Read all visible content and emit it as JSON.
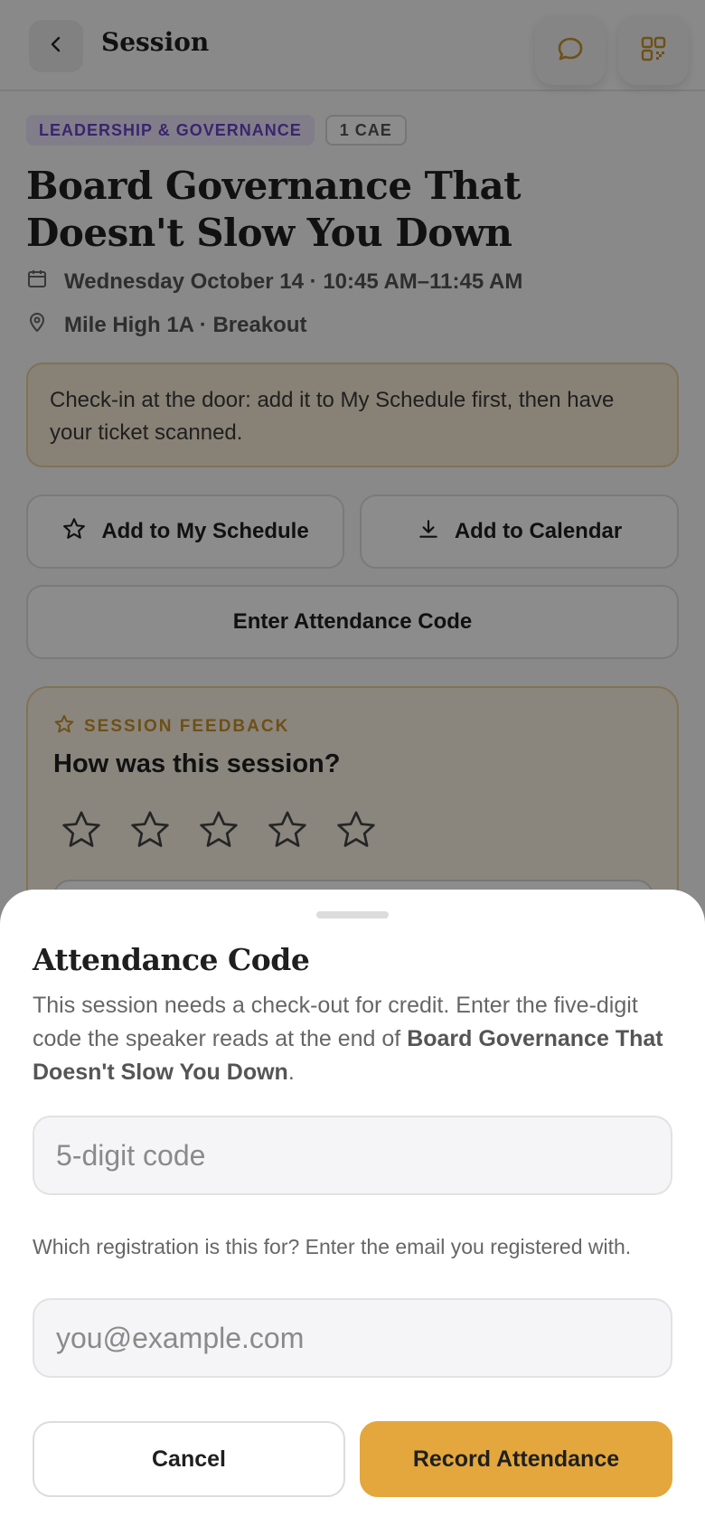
{
  "header": {
    "title": "Session",
    "back_icon": "chevron-left-icon",
    "chat_icon": "chat-bubble-icon",
    "qr_icon": "qr-code-icon",
    "accent_color": "#c8922a"
  },
  "session": {
    "track_badge": "LEADERSHIP & GOVERNANCE",
    "credit_badge": "1 CAE",
    "title": "Board Governance That Doesn't Slow You Down",
    "datetime": "Wednesday October 14 · 10:45 AM–11:45 AM",
    "location": "Mile High 1A · Breakout",
    "checkin_notice": "Check-in at the door: add it to My Schedule first, then have your ticket scanned."
  },
  "actions": {
    "add_schedule": "Add to My Schedule",
    "add_calendar": "Add to Calendar",
    "enter_code": "Enter Attendance Code"
  },
  "feedback": {
    "label": "SESSION FEEDBACK",
    "question": "How was this session?",
    "rating": 0,
    "max_rating": 5
  },
  "sheet": {
    "title": "Attendance Code",
    "description_prefix": "This session needs a check-out for credit. Enter the five-digit code the speaker reads at the end of ",
    "description_session": "Board Governance That Doesn't Slow You Down",
    "description_suffix": ".",
    "code_placeholder": "5-digit code",
    "code_value": "",
    "email_prompt": "Which registration is this for? Enter the email you registered with.",
    "email_placeholder": "you@example.com",
    "email_value": "",
    "cancel_label": "Cancel",
    "record_label": "Record Attendance",
    "record_color": "#e3a73d"
  }
}
